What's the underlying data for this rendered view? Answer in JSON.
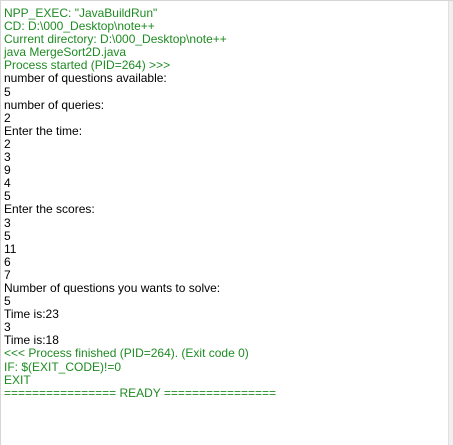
{
  "console": {
    "lines": [
      {
        "text": "NPP_EXEC: \"JavaBuildRun\"",
        "kind": "sys"
      },
      {
        "text": "CD: D:\\000_Desktop\\note++",
        "kind": "sys"
      },
      {
        "text": "Current directory: D:\\000_Desktop\\note++",
        "kind": "sys"
      },
      {
        "text": "java MergeSort2D.java",
        "kind": "sys"
      },
      {
        "text": "Process started (PID=264) >>>",
        "kind": "sys"
      },
      {
        "text": "number of questions available:",
        "kind": "out"
      },
      {
        "text": "5",
        "kind": "out"
      },
      {
        "text": "number of queries:",
        "kind": "out"
      },
      {
        "text": "2",
        "kind": "out"
      },
      {
        "text": "Enter the time:",
        "kind": "out"
      },
      {
        "text": "2",
        "kind": "out"
      },
      {
        "text": "3",
        "kind": "out"
      },
      {
        "text": "9",
        "kind": "out"
      },
      {
        "text": "4",
        "kind": "out"
      },
      {
        "text": "5",
        "kind": "out"
      },
      {
        "text": "Enter the scores:",
        "kind": "out"
      },
      {
        "text": "3",
        "kind": "out"
      },
      {
        "text": "5",
        "kind": "out"
      },
      {
        "text": "11",
        "kind": "out"
      },
      {
        "text": "6",
        "kind": "out"
      },
      {
        "text": "7",
        "kind": "out"
      },
      {
        "text": "Number of questions you wants to solve:",
        "kind": "out"
      },
      {
        "text": "5",
        "kind": "out"
      },
      {
        "text": "Time is:23",
        "kind": "out"
      },
      {
        "text": "3",
        "kind": "out"
      },
      {
        "text": "Time is:18",
        "kind": "out"
      },
      {
        "text": "<<< Process finished (PID=264). (Exit code 0)",
        "kind": "sys"
      },
      {
        "text": "IF: $(EXIT_CODE)!=0",
        "kind": "sys"
      },
      {
        "text": "EXIT",
        "kind": "sys"
      },
      {
        "text": "================ READY ================",
        "kind": "sys"
      }
    ]
  },
  "colors": {
    "system_text": "#1e8b22",
    "program_output": "#000000",
    "background": "#ffffff"
  }
}
